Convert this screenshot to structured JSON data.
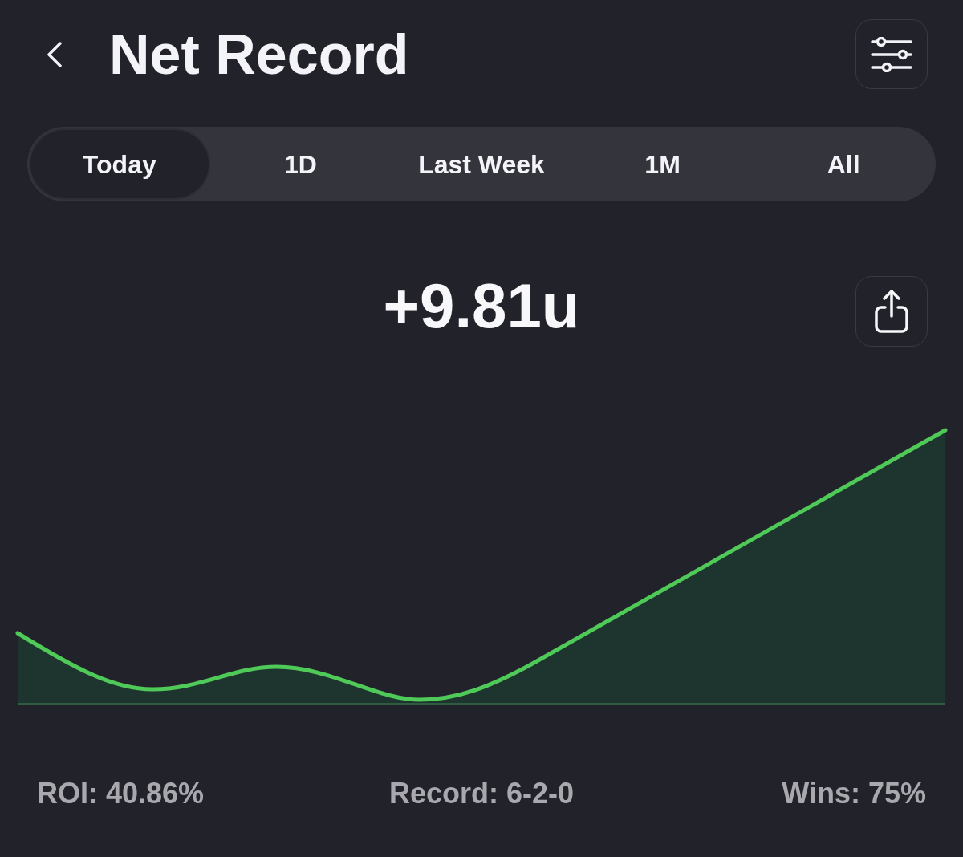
{
  "header": {
    "title": "Net Record"
  },
  "tabs": [
    {
      "label": "Today",
      "selected": true
    },
    {
      "label": "1D",
      "selected": false
    },
    {
      "label": "Last Week",
      "selected": false
    },
    {
      "label": "1M",
      "selected": false
    },
    {
      "label": "All",
      "selected": false
    }
  ],
  "summary": {
    "net_units": "+9.81u"
  },
  "stats": [
    {
      "text": "ROI: 40.86%"
    },
    {
      "text": "Record: 6-2-0"
    },
    {
      "text": "Wins: 75%"
    }
  ]
}
